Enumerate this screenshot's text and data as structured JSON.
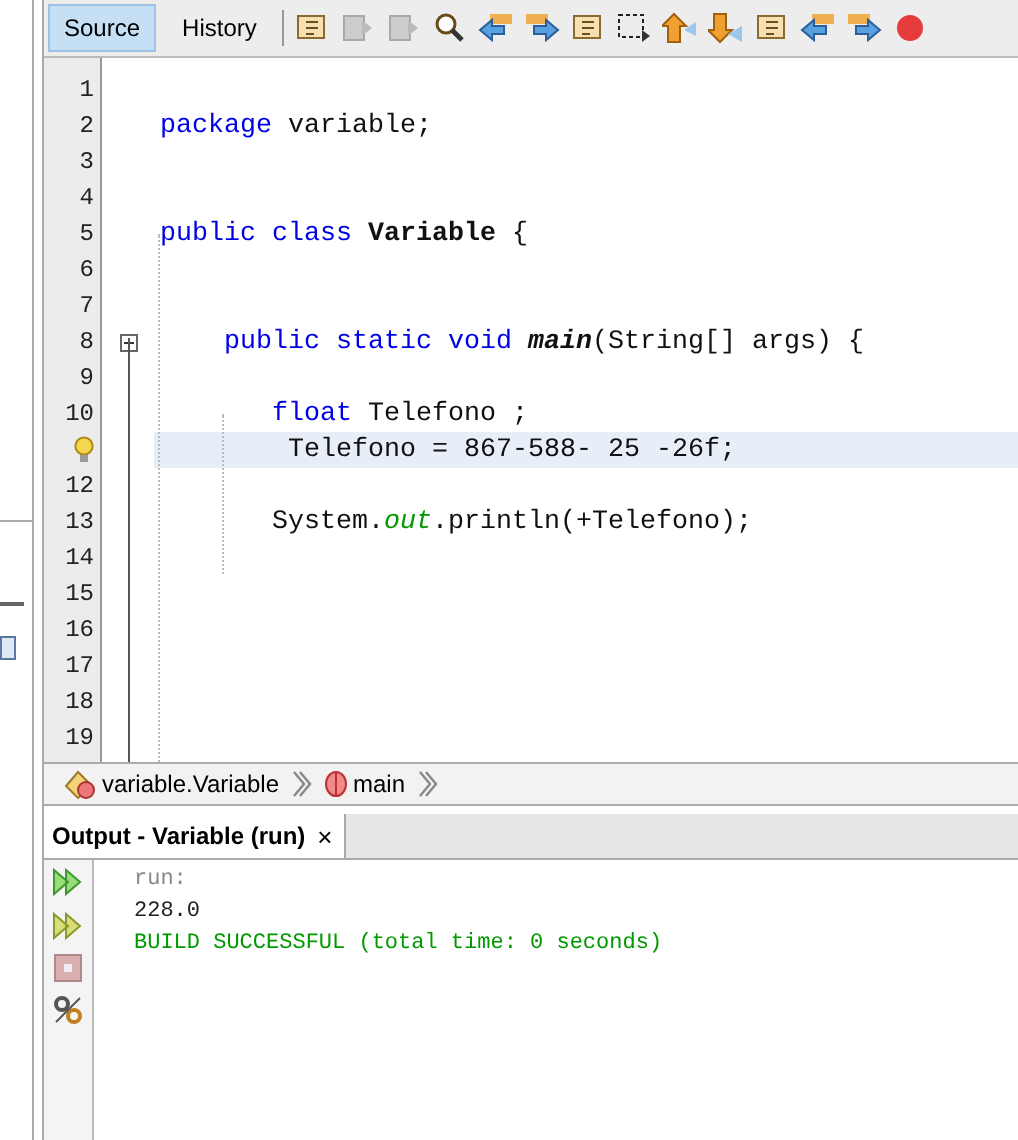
{
  "editor_tabs": [
    {
      "label": "Source",
      "selected": true
    },
    {
      "label": "History",
      "selected": false
    }
  ],
  "code": [
    {
      "number": "1"
    },
    {
      "number": "2",
      "tokens": [
        {
          "kind": "keyword",
          "text": "package"
        },
        {
          "kind": "plain",
          "text": " variable;"
        }
      ]
    },
    {
      "number": "3"
    },
    {
      "number": "4"
    },
    {
      "number": "5",
      "tokens": [
        {
          "kind": "keyword",
          "text": "public class"
        },
        {
          "kind": "bold",
          "text": " Variable"
        },
        {
          "kind": "plain",
          "text": " {"
        }
      ]
    },
    {
      "number": "6"
    },
    {
      "number": "7"
    },
    {
      "number": "8",
      "fold": true,
      "tokens": [
        {
          "kind": "keyword",
          "text": "    public static void"
        },
        {
          "kind": "method",
          "text": " main"
        },
        {
          "kind": "plain",
          "text": "(String[] args) {"
        }
      ]
    },
    {
      "number": "9"
    },
    {
      "number": "10",
      "tokens": [
        {
          "kind": "keyword",
          "text": "       float"
        },
        {
          "kind": "plain",
          "text": " Telefono ;"
        }
      ]
    },
    {
      "hint": true,
      "current": true,
      "tokens": [
        {
          "kind": "plain",
          "text": "        Telefono = 867-588- 25 -26f;"
        }
      ]
    },
    {
      "number": "12"
    },
    {
      "number": "13",
      "tokens": [
        {
          "kind": "plain",
          "text": "       System."
        },
        {
          "kind": "field",
          "text": "out"
        },
        {
          "kind": "plain",
          "text": ".println(+Telefono);"
        }
      ]
    },
    {
      "number": "14"
    },
    {
      "number": "15"
    },
    {
      "number": "16"
    },
    {
      "number": "17"
    },
    {
      "number": "18"
    },
    {
      "number": "19"
    }
  ],
  "breadcrumbs": [
    {
      "kind": "class",
      "label": "variable.Variable"
    },
    {
      "kind": "method",
      "label": "main"
    }
  ],
  "output": {
    "title": "Output - Variable (run)",
    "close": "×",
    "lines": [
      {
        "kind": "info",
        "text": "run:"
      },
      {
        "kind": "plain",
        "text": "228.0"
      },
      {
        "kind": "success",
        "text": "BUILD SUCCESSFUL (total time: 0 seconds)"
      }
    ]
  }
}
